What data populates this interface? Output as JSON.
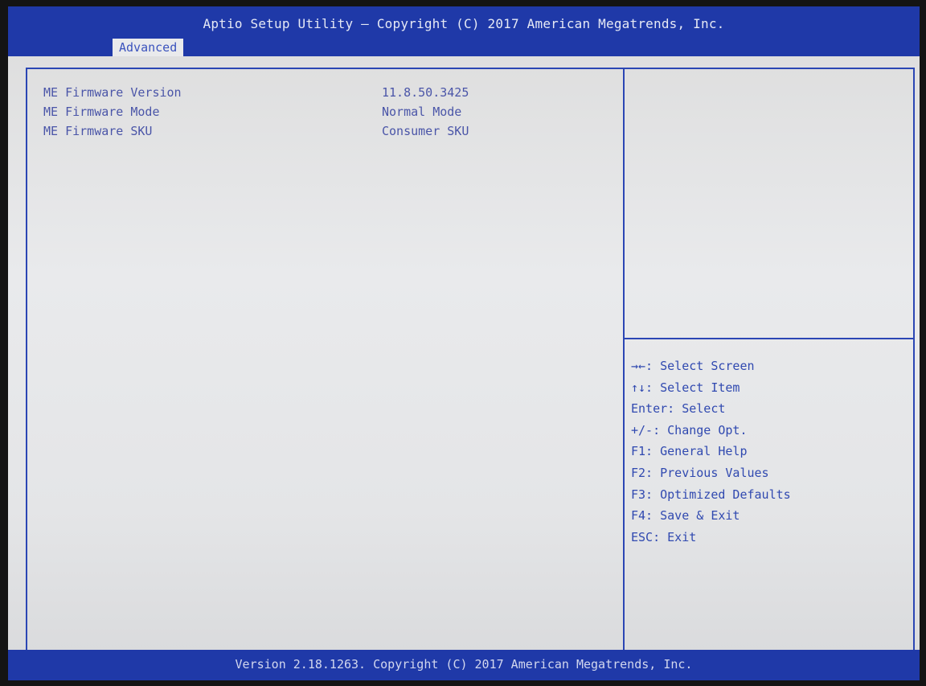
{
  "header": {
    "title": "Aptio Setup Utility – Copyright (C) 2017 American Megatrends, Inc.",
    "active_tab": "Advanced"
  },
  "settings": [
    {
      "label": "ME Firmware Version",
      "value": "11.8.50.3425"
    },
    {
      "label": "ME Firmware Mode",
      "value": "Normal Mode"
    },
    {
      "label": "ME Firmware SKU",
      "value": "Consumer SKU"
    }
  ],
  "help_keys": [
    "→←: Select Screen",
    "↑↓: Select Item",
    "Enter: Select",
    "+/-: Change Opt.",
    "F1: General Help",
    "F2: Previous Values",
    "F3: Optimized Defaults",
    "F4: Save & Exit",
    "ESC: Exit"
  ],
  "footer": {
    "version": "Version 2.18.1263. Copyright (C) 2017 American Megatrends, Inc."
  },
  "colors": {
    "bar": "#1f39a8",
    "text": "#4a55a8",
    "background": "#e4e5e7"
  }
}
